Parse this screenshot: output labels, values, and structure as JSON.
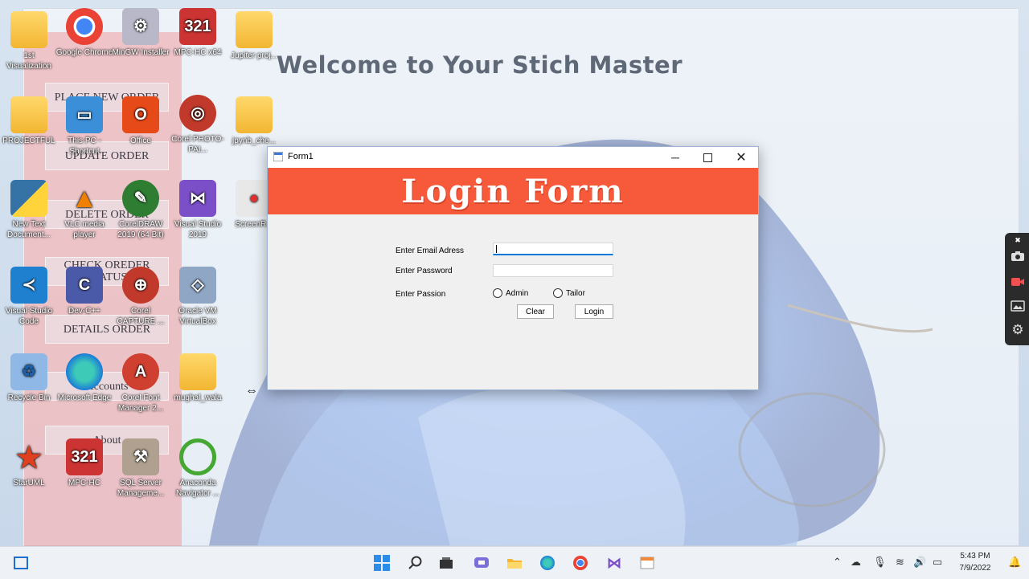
{
  "background_app": {
    "title": "Welcome to Your Stich Master",
    "menu": [
      {
        "label": "PLACE NEW ORDER"
      },
      {
        "label": "UPDATE ORDER"
      },
      {
        "label": "DELETE ORDER"
      },
      {
        "label": "CHECK OREDER STATUS"
      },
      {
        "label": "DETAILS ORDER"
      },
      {
        "label": "Accounts"
      },
      {
        "label": "About"
      }
    ]
  },
  "desktop_icons": [
    {
      "label": "1st Visualization",
      "icon": "folder-icon"
    },
    {
      "label": "Google Chrome",
      "icon": "chrome-icon"
    },
    {
      "label": "MinGW Installer",
      "icon": "mingw-icon"
    },
    {
      "label": "MPC-HC x64",
      "icon": "mpc-icon"
    },
    {
      "label": "Jupiter proj...",
      "icon": "folder-icon"
    },
    {
      "label": "PROJECTFUL",
      "icon": "folder-icon"
    },
    {
      "label": "This PC - Shortcut",
      "icon": "pc-icon"
    },
    {
      "label": "Office",
      "icon": "office-icon"
    },
    {
      "label": "Corel PHOTO-PAI...",
      "icon": "corel-photo-icon"
    },
    {
      "label": "jpynb_che...",
      "icon": "folder-icon"
    },
    {
      "label": "New Text Document...",
      "icon": "python-icon"
    },
    {
      "label": "VLC media player",
      "icon": "vlc-icon"
    },
    {
      "label": "CorelDRAW 2019 (64 Bit)",
      "icon": "coreldraw-icon"
    },
    {
      "label": "Visual Studio 2019",
      "icon": "visual-studio-icon"
    },
    {
      "label": "ScreenR...",
      "icon": "screen-recorder-icon"
    },
    {
      "label": "Visual Studio Code",
      "icon": "vscode-icon"
    },
    {
      "label": "Dev-C++",
      "icon": "devcpp-icon"
    },
    {
      "label": "Corel CAPTURE ...",
      "icon": "corel-capture-icon"
    },
    {
      "label": "Oracle VM VirtualBox",
      "icon": "virtualbox-icon"
    },
    {
      "label": "Recycle Bin",
      "icon": "recycle-bin-icon"
    },
    {
      "label": "Microsoft Edge",
      "icon": "edge-icon"
    },
    {
      "label": "Corel Font Manager 2...",
      "icon": "font-manager-icon"
    },
    {
      "label": "mughal_wala",
      "icon": "folder-icon"
    },
    {
      "label": "StarUML",
      "icon": "staruml-icon"
    },
    {
      "label": "MPC-HC",
      "icon": "mpc-icon"
    },
    {
      "label": "SQL Server Manageme...",
      "icon": "sql-server-icon"
    },
    {
      "label": "Anaconda Navigator ...",
      "icon": "anaconda-icon"
    }
  ],
  "form_window": {
    "title": "Form1",
    "banner": "Login Form",
    "email_label": "Enter Email Adress",
    "email_value": "",
    "password_label": "Enter Password",
    "password_value": "",
    "passion_label": "Enter Passion",
    "radio_admin": "Admin",
    "radio_tailor": "Tailor",
    "clear_button": "Clear",
    "login_button": "Login",
    "banner_color": "#f75a3b"
  },
  "taskbar": {
    "time": "5:43 PM",
    "date": "7/9/2022"
  }
}
